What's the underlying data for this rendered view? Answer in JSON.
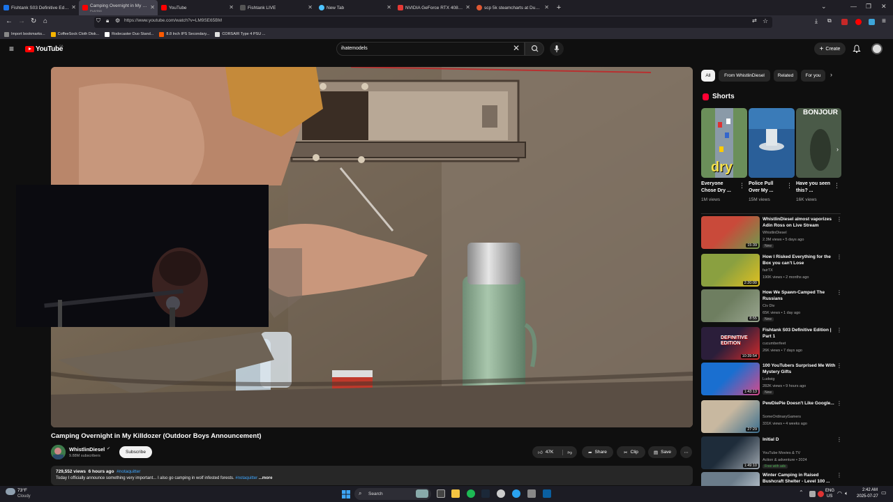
{
  "browser": {
    "tabs": [
      {
        "label": "Fishtank S03 Definitive Edition |",
        "fav": "#1a73e8"
      },
      {
        "label": "Camping Overnight in My Killd",
        "sub": "PLAYING",
        "fav": "#ff0000",
        "active": true
      },
      {
        "label": "YouTube",
        "fav": "#ff0000"
      },
      {
        "label": "Fishtank LIVE",
        "fav": "#333333"
      },
      {
        "label": "New Tab",
        "fav": "#4dc3ff"
      },
      {
        "label": "NVIDIA GeForce RTX 4080 SUP",
        "fav": "#e53935"
      },
      {
        "label": "scp 5k steamcharts at DuckDu",
        "fav": "#de5833"
      }
    ],
    "url": "https://www.youtube.com/watch?v=LM9SE65BM",
    "bookmarks": [
      {
        "label": "Import bookmarks...",
        "color": "#888888"
      },
      {
        "label": "CoffeeSock Cloth Disk...",
        "color": "#f5b400"
      },
      {
        "label": "Rodecaster Duo Stand...",
        "color": "#ffffff"
      },
      {
        "label": "8.8 Inch IPS Secondary...",
        "color": "#ff5a00"
      },
      {
        "label": "CORSAIR Type 4 PSU ...",
        "color": "#e0e0e0"
      }
    ]
  },
  "youtube": {
    "logo_text": "YouTube",
    "logo_country": "CA",
    "search_value": "ihatemodels",
    "create_label": "Create"
  },
  "video": {
    "title": "Camping Overnight in My Killdozer (Outdoor Boys Announcement)",
    "channel": "WhistlinDiesel",
    "subscribers": "9.88M subscribers",
    "subscribe_label": "Subscribe",
    "likes": "47K",
    "share_label": "Share",
    "clip_label": "Clip",
    "save_label": "Save",
    "views": "729,552 views",
    "age": "6 hours ago",
    "tag": "#notaquitter",
    "description": "Today I officially announce something very important...  I also go camping in wolf infested forests.",
    "more_label": "...more"
  },
  "sidebar": {
    "chips": [
      "All",
      "From WhistlinDiesel",
      "Related",
      "For you"
    ],
    "shorts_title": "Shorts",
    "shorts": [
      {
        "title": "Everyone Chose Dry ...",
        "views": "1M views"
      },
      {
        "title": "Police Pull Over My ...",
        "views": "15M views"
      },
      {
        "title": "Have you seen this? ...",
        "views": "16K views",
        "thumb_text": "BONJOUR"
      }
    ],
    "short1_overlay": "dry",
    "recs": [
      {
        "title": "WhistlinDiesel almost vaporizes Adin Ross on Live Stream",
        "channel": "WhistlinDiesel",
        "meta": "2.3M views • 5 days ago",
        "badge": "New",
        "duration": "15:39",
        "c1": "#c94a3a",
        "c2": "#6f9a4e"
      },
      {
        "title": "How I Risked Everything for the Box you can't Lose",
        "channel": "fairTX",
        "meta": "190K views • 2 months ago",
        "badge": "",
        "duration": "2:20:00",
        "c1": "#8aa040",
        "c2": "#e0c020"
      },
      {
        "title": "How We Spawn-Camped The Russians",
        "channel": "Civ Div",
        "meta": "65K views • 1 day ago",
        "badge": "New",
        "duration": "8:55",
        "c1": "#6e7e60",
        "c2": "#9aa690"
      },
      {
        "title": "Fishtank S03 Definitive Edition | Part 1",
        "channel": "cucumberfeet",
        "meta": "26K views • 7 days ago",
        "badge": "",
        "duration": "10:39:54",
        "c1": "#2b1e3a",
        "c2": "#d42a2a"
      },
      {
        "title": "100 YouTubers Surprised Me With Mystery Gifts",
        "channel": "Ludwig",
        "meta": "282K views • 9 hours ago",
        "badge": "New",
        "duration": "1:43:13",
        "c1": "#1a6fd0",
        "c2": "#d84a8a"
      },
      {
        "title": "PewDiePie Doesn't Like Google...",
        "channel": "SomeOrdinaryGamers",
        "meta": "331K views • 4 weeks ago",
        "badge": "",
        "duration": "27:29",
        "c1": "#c8b8a0",
        "c2": "#3c6f8f"
      },
      {
        "title": "Initial D",
        "channel": "YouTube Movies & TV",
        "meta": "Action & adventure • 2024",
        "badge": "Free with ads",
        "duration": "1:49:10",
        "c1": "#1e2c3a",
        "c2": "#a0a8b0"
      },
      {
        "title": "Winter Camping in Raised Bushcraft Shelter - Level 100 ...",
        "channel": "",
        "meta": "",
        "badge": "",
        "duration": "",
        "c1": "#6b7c8a",
        "c2": "#d0d8e0"
      }
    ],
    "rec_thumb_text_4": "DEFINITIVE EDITION"
  },
  "taskbar": {
    "weather_temp": "73°F",
    "weather_cond": "Cloudy",
    "search_label": "Search",
    "lang": "ENG",
    "region": "US",
    "time": "2:42 AM",
    "date": "2025-07-27"
  }
}
